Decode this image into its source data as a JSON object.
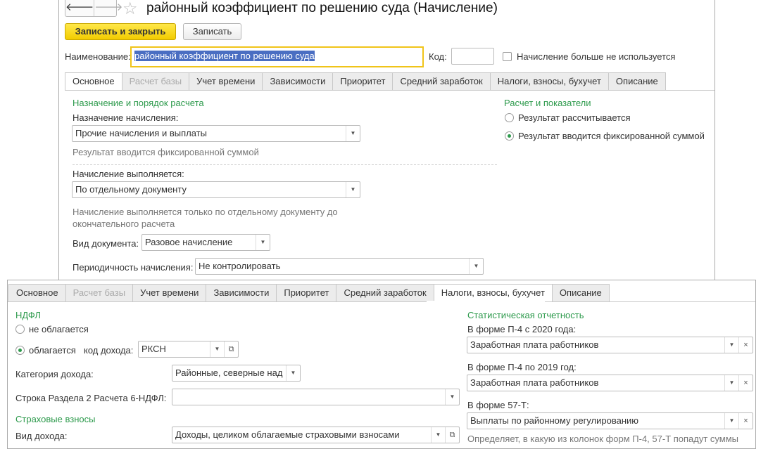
{
  "header": {
    "title": "районный коэффициент по решению суда (Начисление)",
    "back": "🡐",
    "forward": "🡒"
  },
  "toolbar": {
    "save_close": "Записать и закрыть",
    "save": "Записать"
  },
  "form": {
    "name_label": "Наименование:",
    "name_value": "районный коэффициент по решению суда",
    "code_label": "Код:",
    "code_value": "",
    "not_used_label": "Начисление больше не используется"
  },
  "tabs": [
    "Основное",
    "Расчет базы",
    "Учет времени",
    "Зависимости",
    "Приоритет",
    "Средний заработок",
    "Налоги, взносы, бухучет",
    "Описание"
  ],
  "main": {
    "section1": "Назначение и порядок расчета",
    "purpose_label": "Назначение начисления:",
    "purpose_value": "Прочие начисления и выплаты",
    "purpose_hint": "Результат вводится фиксированной суммой",
    "exec_label": "Начисление выполняется:",
    "exec_value": "По отдельному документу",
    "exec_hint": "Начисление выполняется только по отдельному документу до окончательного расчета",
    "doc_label": "Вид документа:",
    "doc_value": "Разовое начисление",
    "period_label": "Периодичность начисления:",
    "period_value": "Не контролировать",
    "section2": "Расчет и показатели",
    "radio1": "Результат рассчитывается",
    "radio2": "Результат вводится фиксированной суммой"
  },
  "taxes": {
    "ndfl": "НДФЛ",
    "not_taxed": "не облагается",
    "taxed": "облагается",
    "code_label": "код дохода:",
    "code_value": "РКСН",
    "category_label": "Категория дохода:",
    "category_value": "Районные, северные над",
    "row_label": "Строка Раздела 2 Расчета 6-НДФЛ:",
    "row_value": "",
    "insurance": "Страховые взносы",
    "income_label": "Вид дохода:",
    "income_value": "Доходы, целиком облагаемые страховыми взносами",
    "stat": "Статистическая отчетность",
    "p4_2020_label": "В форме П-4 с 2020 года:",
    "p4_2020_value": "Заработная плата работников",
    "p4_2019_label": "В форме П-4 по 2019 год:",
    "p4_2019_value": "Заработная плата работников",
    "f57_label": "В форме 57-Т:",
    "f57_value": "Выплаты по районному регулированию",
    "stat_hint": "Определяет, в какую из колонок форм П-4, 57-Т попадут суммы"
  }
}
